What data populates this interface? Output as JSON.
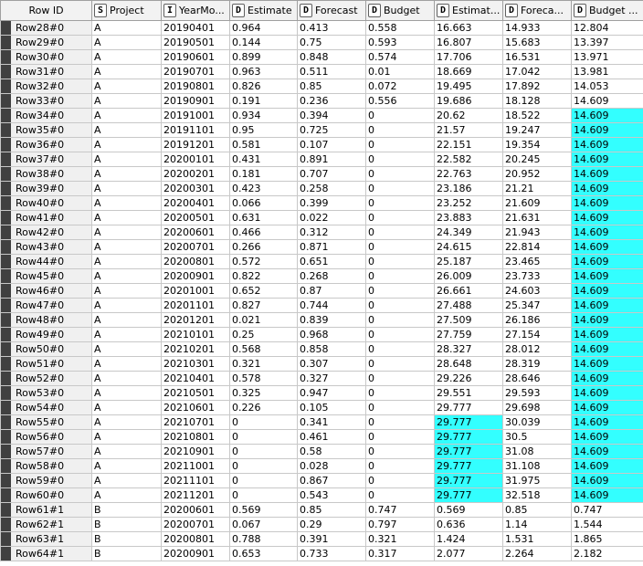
{
  "highlight_color": "#33ffff",
  "columns": [
    {
      "label": "Row ID",
      "type": ""
    },
    {
      "label": "Project",
      "type": "S"
    },
    {
      "label": "YearMo...",
      "type": "I"
    },
    {
      "label": "Estimate",
      "type": "D"
    },
    {
      "label": "Forecast",
      "type": "D"
    },
    {
      "label": "Budget",
      "type": "D"
    },
    {
      "label": "Estimat...",
      "type": "D"
    },
    {
      "label": "Foreca...",
      "type": "D"
    },
    {
      "label": "Budget ...",
      "type": "D"
    }
  ],
  "rows": [
    {
      "id": "Row28#0",
      "cells": [
        "A",
        "20190401",
        "0.964",
        "0.413",
        "0.558",
        "16.663",
        "14.933",
        "12.804"
      ],
      "hl": []
    },
    {
      "id": "Row29#0",
      "cells": [
        "A",
        "20190501",
        "0.144",
        "0.75",
        "0.593",
        "16.807",
        "15.683",
        "13.397"
      ],
      "hl": []
    },
    {
      "id": "Row30#0",
      "cells": [
        "A",
        "20190601",
        "0.899",
        "0.848",
        "0.574",
        "17.706",
        "16.531",
        "13.971"
      ],
      "hl": []
    },
    {
      "id": "Row31#0",
      "cells": [
        "A",
        "20190701",
        "0.963",
        "0.511",
        "0.01",
        "18.669",
        "17.042",
        "13.981"
      ],
      "hl": []
    },
    {
      "id": "Row32#0",
      "cells": [
        "A",
        "20190801",
        "0.826",
        "0.85",
        "0.072",
        "19.495",
        "17.892",
        "14.053"
      ],
      "hl": []
    },
    {
      "id": "Row33#0",
      "cells": [
        "A",
        "20190901",
        "0.191",
        "0.236",
        "0.556",
        "19.686",
        "18.128",
        "14.609"
      ],
      "hl": []
    },
    {
      "id": "Row34#0",
      "cells": [
        "A",
        "20191001",
        "0.934",
        "0.394",
        "0",
        "20.62",
        "18.522",
        "14.609"
      ],
      "hl": [
        7
      ]
    },
    {
      "id": "Row35#0",
      "cells": [
        "A",
        "20191101",
        "0.95",
        "0.725",
        "0",
        "21.57",
        "19.247",
        "14.609"
      ],
      "hl": [
        7
      ]
    },
    {
      "id": "Row36#0",
      "cells": [
        "A",
        "20191201",
        "0.581",
        "0.107",
        "0",
        "22.151",
        "19.354",
        "14.609"
      ],
      "hl": [
        7
      ]
    },
    {
      "id": "Row37#0",
      "cells": [
        "A",
        "20200101",
        "0.431",
        "0.891",
        "0",
        "22.582",
        "20.245",
        "14.609"
      ],
      "hl": [
        7
      ]
    },
    {
      "id": "Row38#0",
      "cells": [
        "A",
        "20200201",
        "0.181",
        "0.707",
        "0",
        "22.763",
        "20.952",
        "14.609"
      ],
      "hl": [
        7
      ]
    },
    {
      "id": "Row39#0",
      "cells": [
        "A",
        "20200301",
        "0.423",
        "0.258",
        "0",
        "23.186",
        "21.21",
        "14.609"
      ],
      "hl": [
        7
      ]
    },
    {
      "id": "Row40#0",
      "cells": [
        "A",
        "20200401",
        "0.066",
        "0.399",
        "0",
        "23.252",
        "21.609",
        "14.609"
      ],
      "hl": [
        7
      ]
    },
    {
      "id": "Row41#0",
      "cells": [
        "A",
        "20200501",
        "0.631",
        "0.022",
        "0",
        "23.883",
        "21.631",
        "14.609"
      ],
      "hl": [
        7
      ]
    },
    {
      "id": "Row42#0",
      "cells": [
        "A",
        "20200601",
        "0.466",
        "0.312",
        "0",
        "24.349",
        "21.943",
        "14.609"
      ],
      "hl": [
        7
      ]
    },
    {
      "id": "Row43#0",
      "cells": [
        "A",
        "20200701",
        "0.266",
        "0.871",
        "0",
        "24.615",
        "22.814",
        "14.609"
      ],
      "hl": [
        7
      ]
    },
    {
      "id": "Row44#0",
      "cells": [
        "A",
        "20200801",
        "0.572",
        "0.651",
        "0",
        "25.187",
        "23.465",
        "14.609"
      ],
      "hl": [
        7
      ]
    },
    {
      "id": "Row45#0",
      "cells": [
        "A",
        "20200901",
        "0.822",
        "0.268",
        "0",
        "26.009",
        "23.733",
        "14.609"
      ],
      "hl": [
        7
      ]
    },
    {
      "id": "Row46#0",
      "cells": [
        "A",
        "20201001",
        "0.652",
        "0.87",
        "0",
        "26.661",
        "24.603",
        "14.609"
      ],
      "hl": [
        7
      ]
    },
    {
      "id": "Row47#0",
      "cells": [
        "A",
        "20201101",
        "0.827",
        "0.744",
        "0",
        "27.488",
        "25.347",
        "14.609"
      ],
      "hl": [
        7
      ]
    },
    {
      "id": "Row48#0",
      "cells": [
        "A",
        "20201201",
        "0.021",
        "0.839",
        "0",
        "27.509",
        "26.186",
        "14.609"
      ],
      "hl": [
        7
      ]
    },
    {
      "id": "Row49#0",
      "cells": [
        "A",
        "20210101",
        "0.25",
        "0.968",
        "0",
        "27.759",
        "27.154",
        "14.609"
      ],
      "hl": [
        7
      ]
    },
    {
      "id": "Row50#0",
      "cells": [
        "A",
        "20210201",
        "0.568",
        "0.858",
        "0",
        "28.327",
        "28.012",
        "14.609"
      ],
      "hl": [
        7
      ]
    },
    {
      "id": "Row51#0",
      "cells": [
        "A",
        "20210301",
        "0.321",
        "0.307",
        "0",
        "28.648",
        "28.319",
        "14.609"
      ],
      "hl": [
        7
      ]
    },
    {
      "id": "Row52#0",
      "cells": [
        "A",
        "20210401",
        "0.578",
        "0.327",
        "0",
        "29.226",
        "28.646",
        "14.609"
      ],
      "hl": [
        7
      ]
    },
    {
      "id": "Row53#0",
      "cells": [
        "A",
        "20210501",
        "0.325",
        "0.947",
        "0",
        "29.551",
        "29.593",
        "14.609"
      ],
      "hl": [
        7
      ]
    },
    {
      "id": "Row54#0",
      "cells": [
        "A",
        "20210601",
        "0.226",
        "0.105",
        "0",
        "29.777",
        "29.698",
        "14.609"
      ],
      "hl": [
        7
      ]
    },
    {
      "id": "Row55#0",
      "cells": [
        "A",
        "20210701",
        "0",
        "0.341",
        "0",
        "29.777",
        "30.039",
        "14.609"
      ],
      "hl": [
        5,
        7
      ]
    },
    {
      "id": "Row56#0",
      "cells": [
        "A",
        "20210801",
        "0",
        "0.461",
        "0",
        "29.777",
        "30.5",
        "14.609"
      ],
      "hl": [
        5,
        7
      ]
    },
    {
      "id": "Row57#0",
      "cells": [
        "A",
        "20210901",
        "0",
        "0.58",
        "0",
        "29.777",
        "31.08",
        "14.609"
      ],
      "hl": [
        5,
        7
      ]
    },
    {
      "id": "Row58#0",
      "cells": [
        "A",
        "20211001",
        "0",
        "0.028",
        "0",
        "29.777",
        "31.108",
        "14.609"
      ],
      "hl": [
        5,
        7
      ]
    },
    {
      "id": "Row59#0",
      "cells": [
        "A",
        "20211101",
        "0",
        "0.867",
        "0",
        "29.777",
        "31.975",
        "14.609"
      ],
      "hl": [
        5,
        7
      ]
    },
    {
      "id": "Row60#0",
      "cells": [
        "A",
        "20211201",
        "0",
        "0.543",
        "0",
        "29.777",
        "32.518",
        "14.609"
      ],
      "hl": [
        5,
        7
      ]
    },
    {
      "id": "Row61#1",
      "cells": [
        "B",
        "20200601",
        "0.569",
        "0.85",
        "0.747",
        "0.569",
        "0.85",
        "0.747"
      ],
      "hl": []
    },
    {
      "id": "Row62#1",
      "cells": [
        "B",
        "20200701",
        "0.067",
        "0.29",
        "0.797",
        "0.636",
        "1.14",
        "1.544"
      ],
      "hl": []
    },
    {
      "id": "Row63#1",
      "cells": [
        "B",
        "20200801",
        "0.788",
        "0.391",
        "0.321",
        "1.424",
        "1.531",
        "1.865"
      ],
      "hl": []
    },
    {
      "id": "Row64#1",
      "cells": [
        "B",
        "20200901",
        "0.653",
        "0.733",
        "0.317",
        "2.077",
        "2.264",
        "2.182"
      ],
      "hl": []
    }
  ]
}
